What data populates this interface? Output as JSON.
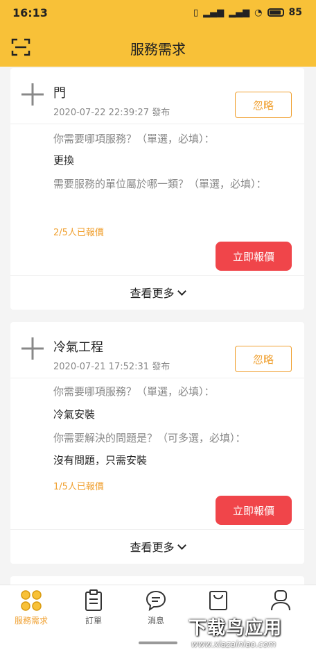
{
  "status_bar": {
    "time": "16:13",
    "battery": "85"
  },
  "header": {
    "title": "服務需求"
  },
  "cards": [
    {
      "title": "門",
      "date": "2020-07-22 22:39:27 發布",
      "ignore_label": "忽略",
      "q1": "你需要哪項服務？（單選，必填）：",
      "a1": "更換",
      "q2": "需要服務的單位屬於哪一類？（單選，必填）：",
      "quoted": "2/5人已報價",
      "quote_label": "立即報價",
      "more_label": "查看更多"
    },
    {
      "title": "冷氣工程",
      "date": "2020-07-21 17:52:31 發布",
      "ignore_label": "忽略",
      "q1": "你需要哪項服務？（單選，必填）：",
      "a1": "冷氣安裝",
      "q2": "你需要解決的問題是？（可多選，必填）：",
      "a2": "沒有問題，只需安裝",
      "quoted": "1/5人已報價",
      "quote_label": "立即報價",
      "more_label": "查看更多"
    }
  ],
  "tabs": [
    {
      "label": "服務需求",
      "icon": "grid-icon",
      "active": true
    },
    {
      "label": "訂單",
      "icon": "clipboard-icon"
    },
    {
      "label": "消息",
      "icon": "chat-icon"
    },
    {
      "label": "",
      "icon": "bag-icon"
    },
    {
      "label": "",
      "icon": "user-icon"
    }
  ],
  "watermark": {
    "cn": "下载鸟应用",
    "en": "www.xiazainiao.com"
  },
  "colors": {
    "brand": "#f8c138",
    "accent": "#f0a030",
    "quote_button": "#f0454a"
  }
}
